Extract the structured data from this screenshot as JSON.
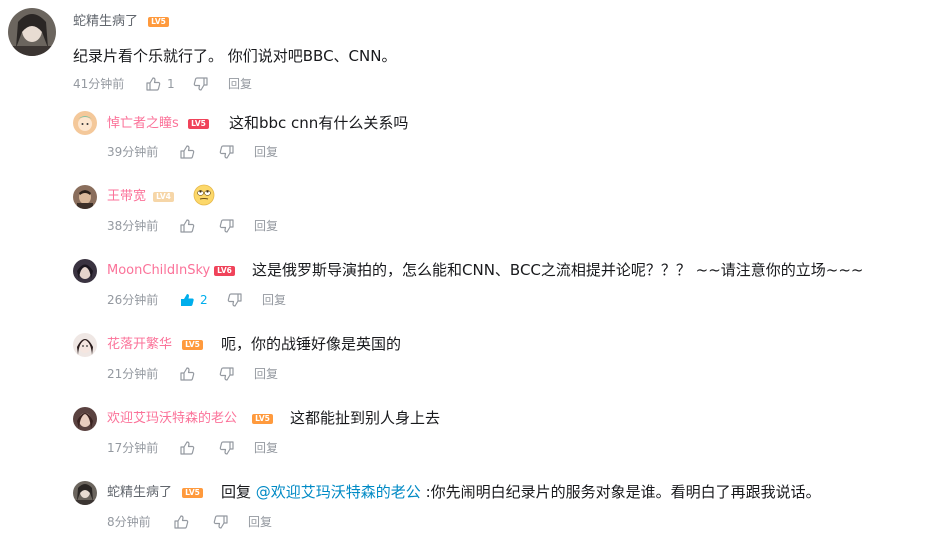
{
  "root_comment": {
    "username": "蛇精生病了",
    "level": "LV5",
    "text": "纪录片看个乐就行了。 你们说对吧BBC、CNN。",
    "time": "41分钟前",
    "like_count": "1",
    "reply_label": "回复"
  },
  "replies": [
    {
      "username": "悼亡者之瞳s",
      "level": "LV5",
      "text": "这和bbc cnn有什么关系吗",
      "time": "39分钟前",
      "like_count": "",
      "reply_label": "回复"
    },
    {
      "username": "王带宽",
      "level": "LV4",
      "text": "",
      "emoji": "eye-roll-emoji",
      "time": "38分钟前",
      "like_count": "",
      "reply_label": "回复"
    },
    {
      "username": "MoonChildInSky",
      "level": "LV6",
      "text": "这是俄罗斯导演拍的，怎么能和CNN、BCC之流相提并论呢？？？ ~~请注意你的立场~~~",
      "time": "26分钟前",
      "like_count": "2",
      "reply_label": "回复"
    },
    {
      "username": "花落开繁华",
      "level": "LV5",
      "text": "呃，你的战锤好像是英国的",
      "time": "21分钟前",
      "like_count": "",
      "reply_label": "回复"
    },
    {
      "username": "欢迎艾玛沃特森的老公",
      "level": "LV5",
      "text": "这都能扯到别人身上去",
      "time": "17分钟前",
      "like_count": "",
      "reply_label": "回复"
    },
    {
      "username": "蛇精生病了",
      "level": "LV5",
      "reply_prefix": "回复 ",
      "mention": "@欢迎艾玛沃特森的老公",
      "text": " :你先闹明白纪录片的服务对象是谁。看明白了再跟我说话。",
      "time": "8分钟前",
      "like_count": "",
      "reply_label": "回复"
    }
  ],
  "colors": {
    "username_vip": "#fb7299",
    "username_plain": "#61666d",
    "meta": "#9499a0",
    "mention": "#008ac5",
    "like_active": "#00aeec",
    "level_orange": "#ff9a3d",
    "level_red": "#f0435a"
  },
  "icons": {
    "like": "thumb-up-icon",
    "dislike": "thumb-down-icon"
  }
}
